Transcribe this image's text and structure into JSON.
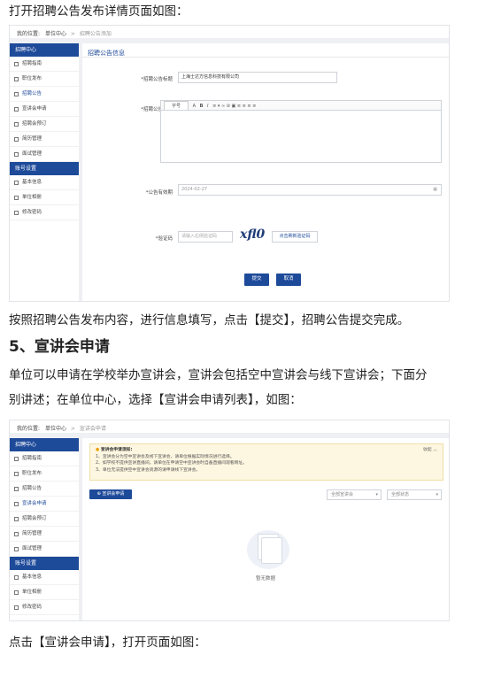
{
  "paragraphs": {
    "p1": "打开招聘公告发布详情页面如图：",
    "p2": "按照招聘公告发布内容，进行信息填写，点击【提交】，招聘公告提交完成。",
    "heading5": "5、宣讲会申请",
    "p3a": "单位可以申请在学校举办宣讲会，宣讲会包括空中宣讲会与线下宣讲会；下面分",
    "p3b": "别讲述；在单位中心，选择【宣讲会申请列表】，如图：",
    "p4": "点击【宣讲会申请】，打开页面如图："
  },
  "screenshot1": {
    "breadcrumb": {
      "location_label": "我的位置:",
      "center": "单位中心",
      "sep": ">",
      "current": "招聘公告添加"
    },
    "sidebar": {
      "group1": "招聘中心",
      "items1": [
        "招聘指南",
        "职位发布",
        "招聘公告",
        "宣讲会申请",
        "招聘会预订",
        "简历管理",
        "面试管理"
      ],
      "group2": "账号设置",
      "items2": [
        "基本信息",
        "单位相册",
        "修改密码"
      ]
    },
    "panel_title": "招聘公告信息",
    "form": {
      "title_label": "*招聘公告标题",
      "title_value": "上海士达方信息科技有限公司",
      "detail_label": "*招聘公告详情",
      "toolbar_font": "字号",
      "toolbar_a": "A",
      "toolbar_b": "B",
      "toolbar_i": "I",
      "toolbar_more": "≡ ▾ ∞ ⊘ ▣ ≡ ≡ ≡ ≡",
      "date_label": "*公告有效期",
      "date_value": "2024-02-27",
      "captcha_label": "*验证码",
      "captcha_placeholder": "请输入右侧验证码",
      "captcha_image_text": "xfl0",
      "captcha_refresh": "点击刷新验证码",
      "submit": "提交",
      "cancel": "取消"
    }
  },
  "screenshot2": {
    "breadcrumb": {
      "location_label": "我的位置:",
      "center": "单位中心",
      "sep": ">",
      "current": "宣讲会申请"
    },
    "sidebar": {
      "group1": "招聘中心",
      "items1": [
        "招聘指南",
        "职位发布",
        "招聘公告",
        "宣讲会申请",
        "招聘会预订",
        "简历管理",
        "面试管理"
      ],
      "group2": "账号设置",
      "items2": [
        "基本信息",
        "单位相册",
        "修改密码"
      ]
    },
    "notice": {
      "title": "宣讲会申请须知:",
      "collapse": "收起 ︿",
      "lines": [
        "1、宣讲会分为空中宣讲会及线下宣讲会，请单位根据实际情况进行选择。",
        "2、如学校不提供宣讲直播间，请单位在申请空中宣讲会时自备直播间观看网址。",
        "3、单位无法提供空中宣讲会资源的请申请线下宣讲会。"
      ]
    },
    "apply_button": "⊕ 宣讲会申请",
    "filter_type": "全部宣讲会",
    "filter_status": "全部状态",
    "empty_text": "暂无数据"
  }
}
